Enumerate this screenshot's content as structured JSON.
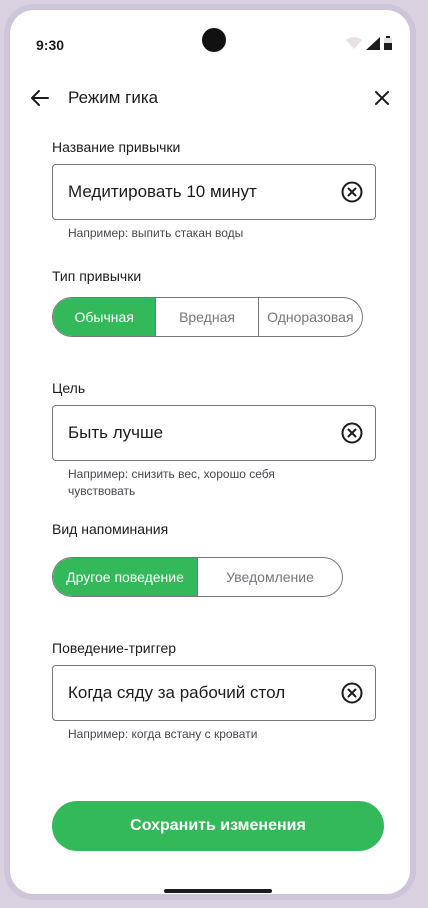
{
  "status_bar": {
    "time": "9:30"
  },
  "top_bar": {
    "title": "Режим гика"
  },
  "habit_name": {
    "label": "Название привычки",
    "value": "Медитировать 10 минут",
    "hint": "Например: выпить стакан воды"
  },
  "habit_type": {
    "label": "Тип привычки",
    "options": [
      "Обычная",
      "Вредная",
      "Одноразовая"
    ],
    "selected": "Обычная"
  },
  "goal": {
    "label": "Цель",
    "value": "Быть лучше",
    "hint": "Например: снизить вес, хорошо себя чувствовать"
  },
  "reminder_type": {
    "label": "Вид напоминания",
    "options": [
      "Другое поведение",
      "Уведомление"
    ],
    "selected": "Другое поведение"
  },
  "trigger": {
    "label": "Поведение-триггер",
    "value": "Когда сяду за рабочий стол",
    "hint": "Например: когда встану с кровати"
  },
  "save_button": {
    "label": "Сохранить изменения"
  },
  "colors": {
    "accent": "#34b95a",
    "outline": "#79747e",
    "text": "#1c1b1f"
  }
}
